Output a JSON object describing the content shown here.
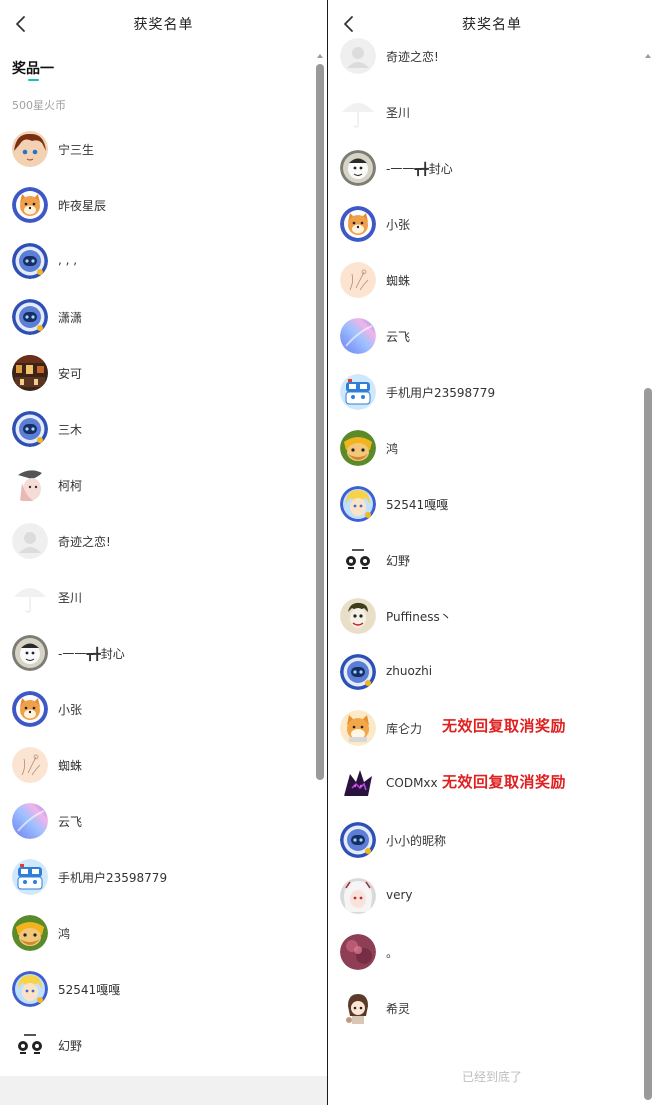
{
  "header": {
    "title": "获奖名单"
  },
  "left": {
    "tab_label": "奖品一",
    "prize_desc": "500星火币",
    "winners": [
      {
        "name": "宁三生",
        "avatar": "anime-boy"
      },
      {
        "name": "昨夜星辰",
        "avatar": "shiba-blue"
      },
      {
        "name": ", , ,",
        "avatar": "robot-blue"
      },
      {
        "name": "潇潇",
        "avatar": "robot-blue"
      },
      {
        "name": "安可",
        "avatar": "photo-dark"
      },
      {
        "name": "三木",
        "avatar": "robot-blue"
      },
      {
        "name": "柯柯",
        "avatar": "anime-white"
      },
      {
        "name": "奇迹之恋!",
        "avatar": "default-gray"
      },
      {
        "name": "圣川",
        "avatar": "umbrella"
      },
      {
        "name": "-一一┳╋封心",
        "avatar": "monkey-gray"
      },
      {
        "name": "小张",
        "avatar": "shiba-blue"
      },
      {
        "name": "蜘蛛",
        "avatar": "sketch-peach"
      },
      {
        "name": "云飞",
        "avatar": "gradient-blue"
      },
      {
        "name": "手机用户23598779",
        "avatar": "robot-car"
      },
      {
        "name": "鸿",
        "avatar": "barbarian"
      },
      {
        "name": "52541嘎嘎",
        "avatar": "blonde-kid"
      },
      {
        "name": "幻野",
        "avatar": "panda-text"
      }
    ]
  },
  "right": {
    "winners": [
      {
        "name": "奇迹之恋!",
        "avatar": "default-gray"
      },
      {
        "name": "圣川",
        "avatar": "umbrella"
      },
      {
        "name": "-一一┳╋封心",
        "avatar": "monkey-gray"
      },
      {
        "name": "小张",
        "avatar": "shiba-blue"
      },
      {
        "name": "蜘蛛",
        "avatar": "sketch-peach"
      },
      {
        "name": "云飞",
        "avatar": "gradient-blue"
      },
      {
        "name": "手机用户23598779",
        "avatar": "robot-car"
      },
      {
        "name": "鸿",
        "avatar": "barbarian"
      },
      {
        "name": "52541嘎嘎",
        "avatar": "blonde-kid"
      },
      {
        "name": "幻野",
        "avatar": "panda-text"
      },
      {
        "name": "Puffiness丶",
        "avatar": "joker"
      },
      {
        "name": "zhuozhi",
        "avatar": "robot-blue"
      },
      {
        "name": "库仑力",
        "avatar": "shiba-yellow",
        "flag": "无效回复取消奖励"
      },
      {
        "name": "CODMxx",
        "avatar": "dark-villain",
        "flag": "无效回复取消奖励"
      },
      {
        "name": "小小的昵称",
        "avatar": "robot-blue"
      },
      {
        "name": "very",
        "avatar": "anime-girl-white"
      },
      {
        "name": "。",
        "avatar": "dark-pink"
      },
      {
        "name": "希灵",
        "avatar": "chibi-girl"
      }
    ],
    "end_text": "已经到底了"
  },
  "colors": {
    "accent": "#12c3b6",
    "flag_red": "#e02020",
    "muted_text": "#a0a0a0",
    "divider": "#1c1c1c"
  },
  "icons": {
    "back": "chevron-left-icon"
  }
}
